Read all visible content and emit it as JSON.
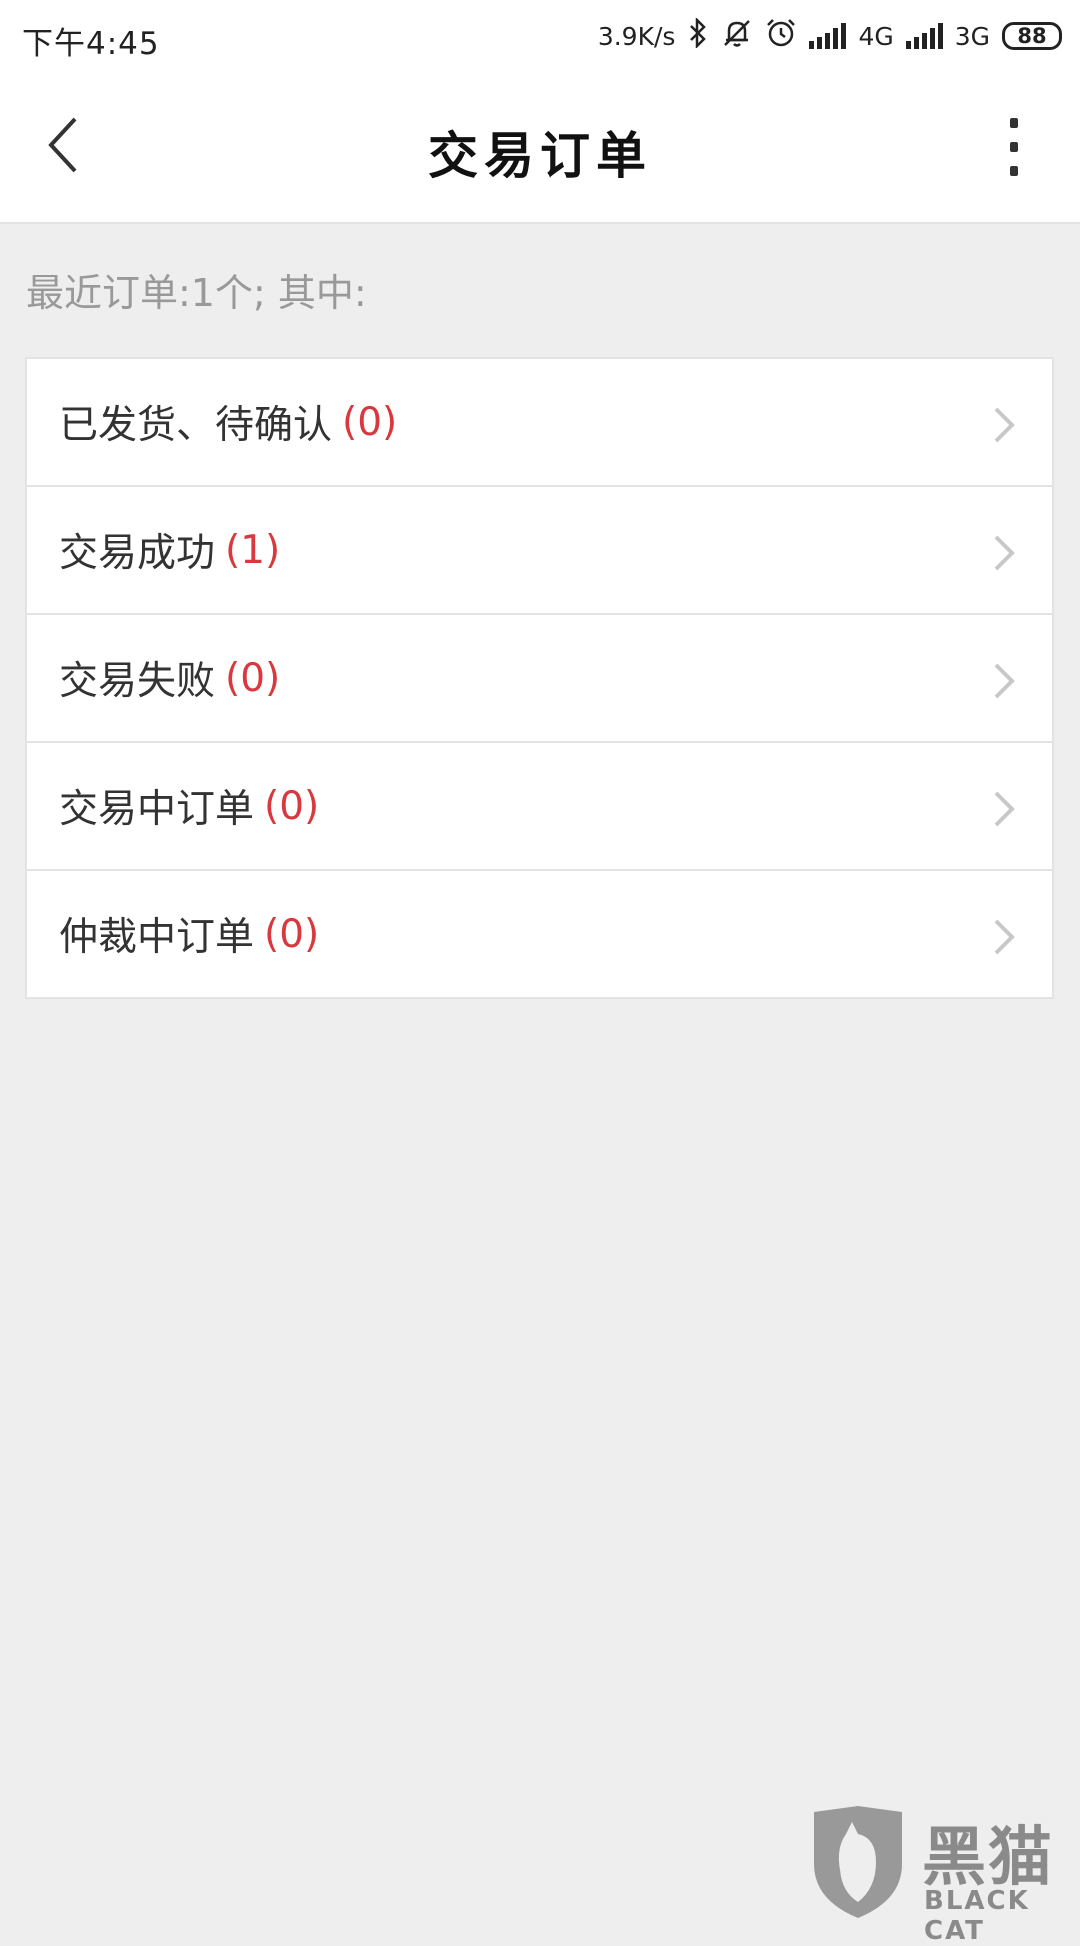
{
  "status_bar": {
    "time": "下午4:45",
    "net_speed": "3.9K/s",
    "network_1": "4G",
    "network_2": "3G",
    "battery": "88",
    "icons": [
      "bluetooth-icon",
      "mute-icon",
      "alarm-icon",
      "signal-icon",
      "signal-icon"
    ]
  },
  "header": {
    "title": "交易订单",
    "back_icon": "chevron-left-icon",
    "more_icon": "more-vertical-icon"
  },
  "summary": {
    "text": "最近订单:1个; 其中:"
  },
  "orders": [
    {
      "label": "已发货、待确认",
      "count": "(0)"
    },
    {
      "label": "交易成功",
      "count": "(1)"
    },
    {
      "label": "交易失败",
      "count": "(0)"
    },
    {
      "label": "交易中订单",
      "count": "(0)"
    },
    {
      "label": "仲裁中订单",
      "count": "(0)"
    }
  ],
  "watermark": {
    "text": "黑猫",
    "subtext": "BLACK CAT"
  },
  "colors": {
    "background": "#eeeeee",
    "count_accent": "#d9393e",
    "label": "#333333",
    "summary": "#999999"
  }
}
